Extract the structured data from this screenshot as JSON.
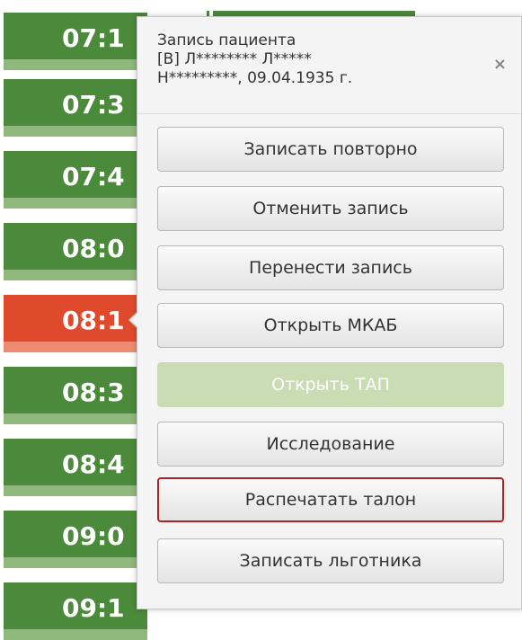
{
  "schedule": {
    "slots": [
      {
        "time": "07:1"
      },
      {
        "time": "07:3"
      },
      {
        "time": "07:4"
      },
      {
        "time": "08:0"
      },
      {
        "time": "08:1"
      },
      {
        "time": "08:3"
      },
      {
        "time": "08:4"
      },
      {
        "time": "09:0"
      },
      {
        "time": "09:1"
      }
    ]
  },
  "popup": {
    "title": "Запись пациента",
    "patient_name": "[В] Л******** Л*****",
    "patient_info": "Н*********, 09.04.1935 г.",
    "close_label": "×",
    "buttons": {
      "rebook": "Записать повторно",
      "cancel": "Отменить запись",
      "move": "Перенести запись",
      "open_mkab": "Открыть МКАБ",
      "open_tap": "Открыть ТАП",
      "research": "Исследование",
      "print_ticket": "Распечатать талон",
      "book_beneficiary": "Записать льготника"
    }
  },
  "colors": {
    "slot_green": "#4a8a3a",
    "slot_selected": "#e04a2c",
    "highlight_border": "#b52024"
  }
}
